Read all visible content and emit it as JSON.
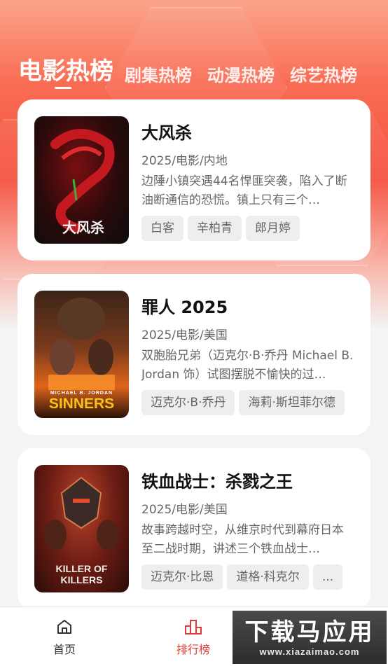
{
  "tabs": [
    {
      "label": "电影热榜",
      "active": true
    },
    {
      "label": "剧集热榜",
      "active": false
    },
    {
      "label": "动漫热榜",
      "active": false
    },
    {
      "label": "综艺热榜",
      "active": false
    }
  ],
  "movies": [
    {
      "title": "大风杀",
      "meta": "2025/电影/内地",
      "description": "边陲小镇突遇44名悍匪突袭，陷入了断油断通信的恐慌。镇上只有三个…",
      "tags": [
        "白客",
        "辛柏青",
        "郎月婷"
      ],
      "poster_caption": "大风杀",
      "poster_colors": [
        "#111111",
        "#b3151b"
      ]
    },
    {
      "title": "罪人 2025",
      "meta": "2025/电影/美国",
      "description": "双胞胎兄弟（迈克尔·B·乔丹 Michael B. Jordan 饰）试图摆脱不愉快的过…",
      "tags": [
        "迈克尔·B·乔丹",
        "海莉·斯坦菲尔德"
      ],
      "poster_caption": "SINNERS",
      "poster_credit": "MICHAEL B. JORDAN",
      "poster_colors": [
        "#2a1a12",
        "#d9691e"
      ]
    },
    {
      "title": "铁血战士：杀戮之王",
      "meta": "2025/电影/美国",
      "description": "故事跨越时空，从维京时代到幕府日本至二战时期，讲述三个铁血战士…",
      "tags": [
        "迈克尔·比恩",
        "道格·科克尔",
        "..."
      ],
      "poster_caption": "KILLER OF KILLERS",
      "poster_colors": [
        "#3a1410",
        "#c8462a"
      ]
    }
  ],
  "bottom_nav": [
    {
      "label": "首页",
      "icon": "home-icon",
      "active": false
    },
    {
      "label": "排行榜",
      "icon": "ranking-icon",
      "active": true
    }
  ],
  "watermark": {
    "text": "下载马应用",
    "url": "www.xiazaimao.com"
  },
  "colors": {
    "accent": "#e53935",
    "header_top": "#fba48a",
    "header_mid": "#f5513f"
  }
}
